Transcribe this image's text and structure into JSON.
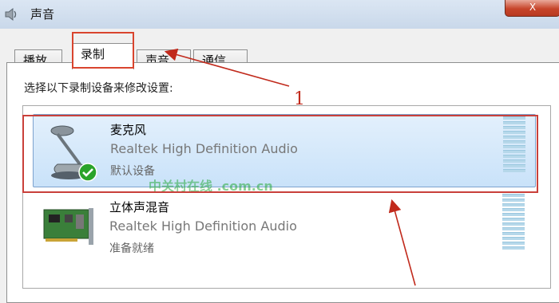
{
  "window": {
    "title": "声音",
    "close_label": "X"
  },
  "tabs": [
    {
      "label": "播放",
      "active": false
    },
    {
      "label": "录制",
      "active": true
    },
    {
      "label": "声音",
      "active": false
    },
    {
      "label": "通信",
      "active": false
    }
  ],
  "instruction": "选择以下录制设备来修改设置:",
  "devices": [
    {
      "name": "麦克风",
      "description": "Realtek High Definition Audio",
      "status": "默认设备",
      "icon": "microphone-icon",
      "selected": true,
      "default_check": true
    },
    {
      "name": "立体声混音",
      "description": "Realtek High Definition Audio",
      "status": "准备就绪",
      "icon": "sound-card-icon",
      "selected": false,
      "default_check": false
    }
  ],
  "annotation": {
    "number": "1",
    "color": "#c12a1c"
  },
  "watermark": {
    "text": "中关村在线 .com.cn"
  },
  "colors": {
    "selection_bg": "#c9e2f9",
    "highlight_border": "#c9403a",
    "check_green": "#2aa32a"
  }
}
